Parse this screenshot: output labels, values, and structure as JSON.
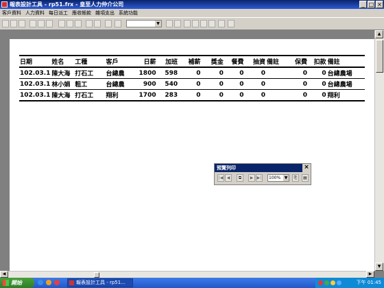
{
  "window": {
    "title": "報表設計工具 - rp51.frx - 皇至人力仲介公司",
    "controls": [
      "_",
      "□",
      "×"
    ]
  },
  "menu": [
    "客戶資料",
    "人力資料",
    "每日派工",
    "應收帳款",
    "雜項支出",
    "系統功能"
  ],
  "report": {
    "headers": [
      "日期",
      "姓名",
      "工種",
      "客戶",
      "日薪",
      "加班",
      "補薪",
      "獎金",
      "餐費",
      "抽資",
      "備註",
      "保費",
      "扣款",
      "備註"
    ],
    "rows": [
      [
        "102.03.1",
        "陳大海",
        "打石工",
        "台總農",
        "1800",
        "598",
        "0",
        "0",
        "0",
        "0",
        "",
        "0",
        "0",
        "台總農場"
      ],
      [
        "102.03.1",
        "林小娟",
        "粗工",
        "台總農",
        "900",
        "540",
        "0",
        "0",
        "0",
        "0",
        "",
        "0",
        "0",
        "台總農場"
      ],
      [
        "102.03.1",
        "陳大海",
        "打石工",
        "翔利",
        "1700",
        "283",
        "0",
        "0",
        "0",
        "0",
        "",
        "0",
        "0",
        "翔利"
      ]
    ]
  },
  "preview_toolbar": {
    "title": "預覽列印",
    "close": "×",
    "zoom": "100%"
  },
  "taskbar": {
    "start": "開始",
    "task": "報表設計工具 - rp51...",
    "clock": "下午 01:45"
  }
}
